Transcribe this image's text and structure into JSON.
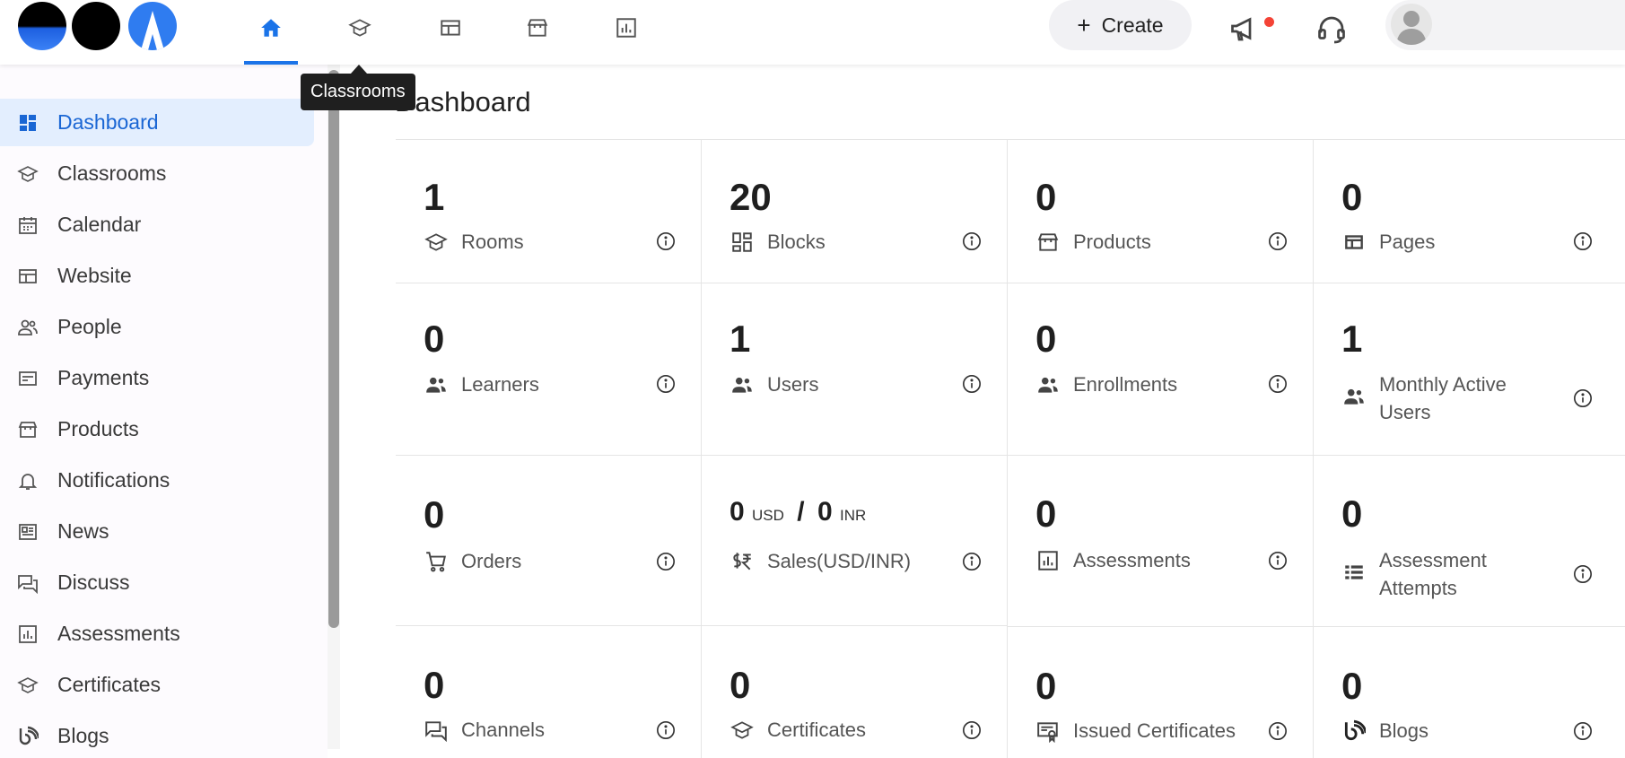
{
  "tooltip": "Classrooms",
  "create_label": "Create",
  "page_title": "Dashboard",
  "accent_color": "#1a73e8",
  "sidebar": {
    "items": [
      {
        "label": "Dashboard",
        "icon": "dashboard-icon",
        "active": true
      },
      {
        "label": "Classrooms",
        "icon": "classroom-icon"
      },
      {
        "label": "Calendar",
        "icon": "calendar-icon"
      },
      {
        "label": "Website",
        "icon": "website-icon"
      },
      {
        "label": "People",
        "icon": "people-icon"
      },
      {
        "label": "Payments",
        "icon": "payments-icon"
      },
      {
        "label": "Products",
        "icon": "store-icon"
      },
      {
        "label": "Notifications",
        "icon": "bell-icon"
      },
      {
        "label": "News",
        "icon": "news-icon"
      },
      {
        "label": "Discuss",
        "icon": "discuss-icon"
      },
      {
        "label": "Assessments",
        "icon": "assessment-icon"
      },
      {
        "label": "Certificates",
        "icon": "certificate-icon"
      },
      {
        "label": "Blogs",
        "icon": "blog-icon"
      }
    ]
  },
  "stats": {
    "rooms": {
      "value": "1",
      "label": "Rooms"
    },
    "blocks": {
      "value": "20",
      "label": "Blocks"
    },
    "products": {
      "value": "0",
      "label": "Products"
    },
    "pages": {
      "value": "0",
      "label": "Pages"
    },
    "learners": {
      "value": "0",
      "label": "Learners"
    },
    "users": {
      "value": "1",
      "label": "Users"
    },
    "enrollments": {
      "value": "0",
      "label": "Enrollments"
    },
    "mau": {
      "value": "1",
      "label1": "Monthly Active",
      "label2": "Users"
    },
    "orders": {
      "value": "0",
      "label": "Orders"
    },
    "sales": {
      "usd": "0",
      "usd_unit": "USD",
      "sep": "/",
      "inr": "0",
      "inr_unit": "INR",
      "label": "Sales(USD/INR)"
    },
    "assessments": {
      "value": "0",
      "label": "Assessments"
    },
    "attempts": {
      "value": "0",
      "label1": "Assessment",
      "label2": "Attempts"
    },
    "channels": {
      "value": "0",
      "label": "Channels"
    },
    "certificates": {
      "value": "0",
      "label": "Certificates"
    },
    "issued": {
      "value": "0",
      "label": "Issued Certificates"
    },
    "blogs": {
      "value": "0",
      "label": "Blogs"
    }
  }
}
